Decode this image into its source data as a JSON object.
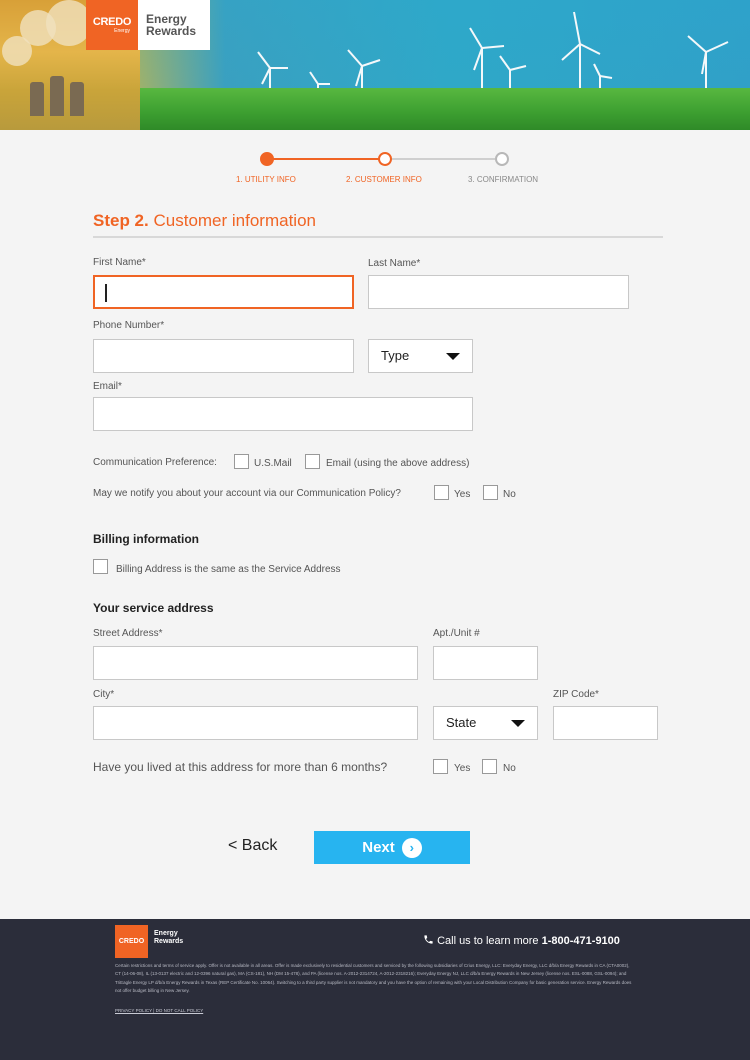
{
  "brand": {
    "logo_line1": "CREDO",
    "logo_line2": "Energy",
    "words_line1": "Energy",
    "words_line2": "Rewards"
  },
  "steps": [
    {
      "label": "1. UTILITY INFO",
      "state": "done"
    },
    {
      "label": "2. CUSTOMER INFO",
      "state": "active"
    },
    {
      "label": "3. CONFIRMATION",
      "state": "todo"
    }
  ],
  "form": {
    "title_bold": "Step 2.",
    "title_rest": "Customer information",
    "first_name_label": "First Name*",
    "last_name_label": "Last Name*",
    "phone_label": "Phone Number*",
    "phone_type": "Type",
    "email_label": "Email*",
    "comm_pref_label": "Communication Preference:",
    "comm_usmail": "U.S.Mail",
    "comm_email": "Email (using the above address)",
    "notify_label": "May we notify you about your account via our Communication Policy?",
    "yes": "Yes",
    "no": "No"
  },
  "billing": {
    "heading": "Billing information",
    "same_address": "Billing Address is the same as the Service Address"
  },
  "service": {
    "heading": "Your service address",
    "street_label": "Street Address*",
    "apt_label": "Apt./Unit #",
    "city_label": "City*",
    "zip_label": "ZIP Code*",
    "state_value": "State",
    "lived_label": "Have you lived at this address for more than 6 months?",
    "yes": "Yes",
    "no": "No"
  },
  "nav": {
    "back_label": "< Back",
    "next_label": "Next",
    "next_icon": "›"
  },
  "footer": {
    "logo": "CREDO",
    "words_line1": "Energy",
    "words_line2": "Rewards",
    "call_prefix": "Call us to learn more",
    "phone": "1-800-471-9100",
    "fine_print": "Certain restrictions and terms of service apply. Offer is not available in all areas. Offer is made exclusively to residential customers and serviced by the following subsidiaries of Crius Energy, LLC: Everyday Energy, LLC d/b/a Energy Rewards in CA (CTA0002), CT (14-06-08), IL (13-0137 electric and 12-0396 natural gas), MA (CS-181), NH (DM 15-478), and PA (license nos. A-2012-2314724, A-2012-2318216); Everyday Energy NJ, LLC d/b/a Energy Rewards in New Jersey (license nos. ESL-0088, GSL-0094); and TriEagle Energy LP d/b/a Energy Rewards in Texas (REP Certificate No. 10064). Switching to a third party supplier is not mandatory and you have the option of remaining with your Local Distribution Company for basic generation service. Energy Rewards does not offer budget billing in New Jersey.",
    "links": "PRIVACY POLICY | DO NOT CALL POLICY"
  },
  "colors": {
    "accent": "#f06424",
    "next_button": "#27b4f0",
    "footer_bg": "#2b2d3a"
  }
}
